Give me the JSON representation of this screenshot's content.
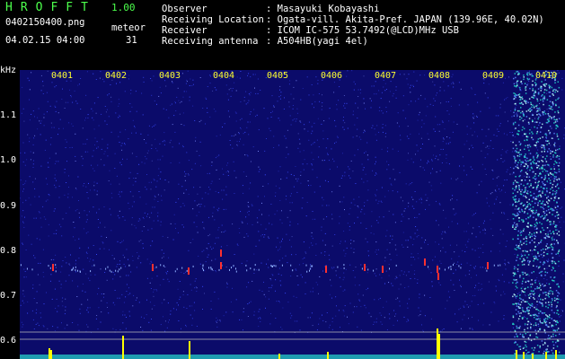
{
  "header": {
    "title": "HROFFT",
    "version": "1.00",
    "filename": "0402150400.png",
    "datetime": "04.02.15 04:00",
    "meteor_label": "meteor",
    "meteor_count": "31"
  },
  "meta": [
    {
      "label": "Observer",
      "value": ": Masayuki Kobayashi"
    },
    {
      "label": "Receiving Location",
      "value": ": Ogata-vill. Akita-Pref. JAPAN (139.96E, 40.02N)"
    },
    {
      "label": "Receiver",
      "value": ": ICOM IC-575 53.7492(@LCD)MHz USB"
    },
    {
      "label": "Receiving antenna",
      "value": ": A504HB(yagi 4el)"
    }
  ],
  "axis": {
    "unit": "kHz",
    "y_labels": [
      "1.1",
      "1.0",
      "0.9",
      "0.8",
      "0.7",
      "0.6"
    ],
    "time_labels": [
      "0401",
      "0402",
      "0403",
      "0404",
      "0405",
      "0406",
      "0407",
      "0408",
      "0409",
      "0410"
    ]
  },
  "colors": {
    "background": "#0b0b6a",
    "noise": "#3a4cff",
    "signal": "#ff3030",
    "interference": "#22d4c8",
    "text": "#ffffff",
    "accent": "#4cff4c",
    "time_label": "#ffff30",
    "meter": "#ffff00"
  }
}
